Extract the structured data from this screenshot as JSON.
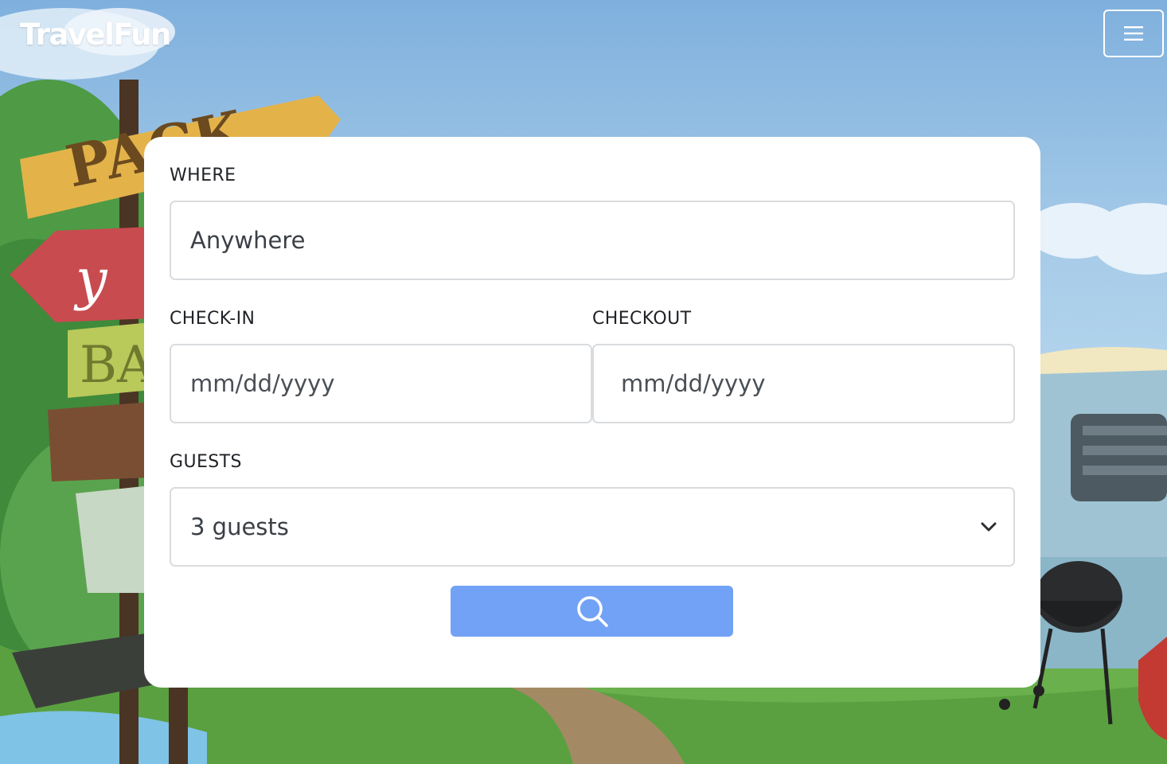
{
  "header": {
    "brand": "TravelFun",
    "menu_icon": "hamburger-menu-icon"
  },
  "search_form": {
    "where": {
      "label": "WHERE",
      "value": "Anywhere"
    },
    "check_in": {
      "label": "CHECK-IN",
      "placeholder": "mm/dd/yyyy"
    },
    "checkout": {
      "label": "CHECKOUT",
      "placeholder": "mm/dd/yyyy"
    },
    "guests": {
      "label": "GUESTS",
      "selected": "3 guests",
      "icon": "chevron-down-icon"
    },
    "submit": {
      "icon": "search-icon",
      "color": "#72a2f5"
    }
  },
  "background": {
    "scene": "illustrated travel scene with signpost, camper van and grill"
  }
}
